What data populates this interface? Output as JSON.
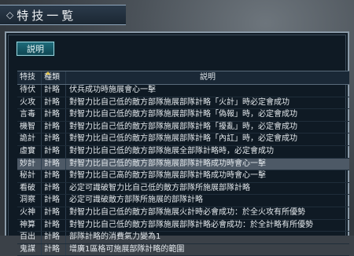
{
  "window": {
    "title": "特技一覧"
  },
  "help_button": {
    "label": "説明"
  },
  "table": {
    "headers": {
      "name": "特技",
      "type": "種類",
      "description": "説明"
    },
    "rows": [
      {
        "name": "待伏",
        "type": "計略",
        "description": "伏兵成功時施展會心一擊"
      },
      {
        "name": "火攻",
        "type": "計略",
        "description": "對智力比自己低的敵方部隊施展部隊計略「火計」時必定會成功"
      },
      {
        "name": "言毒",
        "type": "計略",
        "description": "對智力比自己低的敵方部隊施展部隊計略「偽報」時，必定會成功"
      },
      {
        "name": "機智",
        "type": "計略",
        "description": "對智力比自己低的敵方部隊施展部隊計略「擾亂」時，必定會成功"
      },
      {
        "name": "詭計",
        "type": "計略",
        "description": "對智力比自己低的敵方部隊施展部隊計略「內訌」時，必定會成功"
      },
      {
        "name": "虛實",
        "type": "計略",
        "description": "對智力比自己低的敵方部隊施展全部隊計略時，必定會成功"
      },
      {
        "name": "妙計",
        "type": "計略",
        "description": "對智力比自己低的敵方部隊施展部隊計略成功時會心一擊"
      },
      {
        "name": "秘計",
        "type": "計略",
        "description": "對智力比自己高的敵方部隊施展部隊計略成功時會心一擊"
      },
      {
        "name": "看破",
        "type": "計略",
        "description": "必定可識破智力比自己低的敵方部隊所施展部隊計略"
      },
      {
        "name": "洞察",
        "type": "計略",
        "description": "必定可識破敵方部隊所施展的部隊計略"
      },
      {
        "name": "火神",
        "type": "計略",
        "description": "對智力比自己低的敵方部隊施展火計時必會成功：於全火攻有所優勢"
      },
      {
        "name": "神算",
        "type": "計略",
        "description": "對智力比自己低的敵方部隊施展部隊計略必會成功：於全計略有所優勢"
      },
      {
        "name": "百出",
        "type": "計略",
        "description": "部隊計略的消費氣力變為1"
      },
      {
        "name": "鬼謀",
        "type": "計略",
        "description": "增廣1區格可施展部隊計略的範圍"
      }
    ],
    "selected_index": 6
  }
}
